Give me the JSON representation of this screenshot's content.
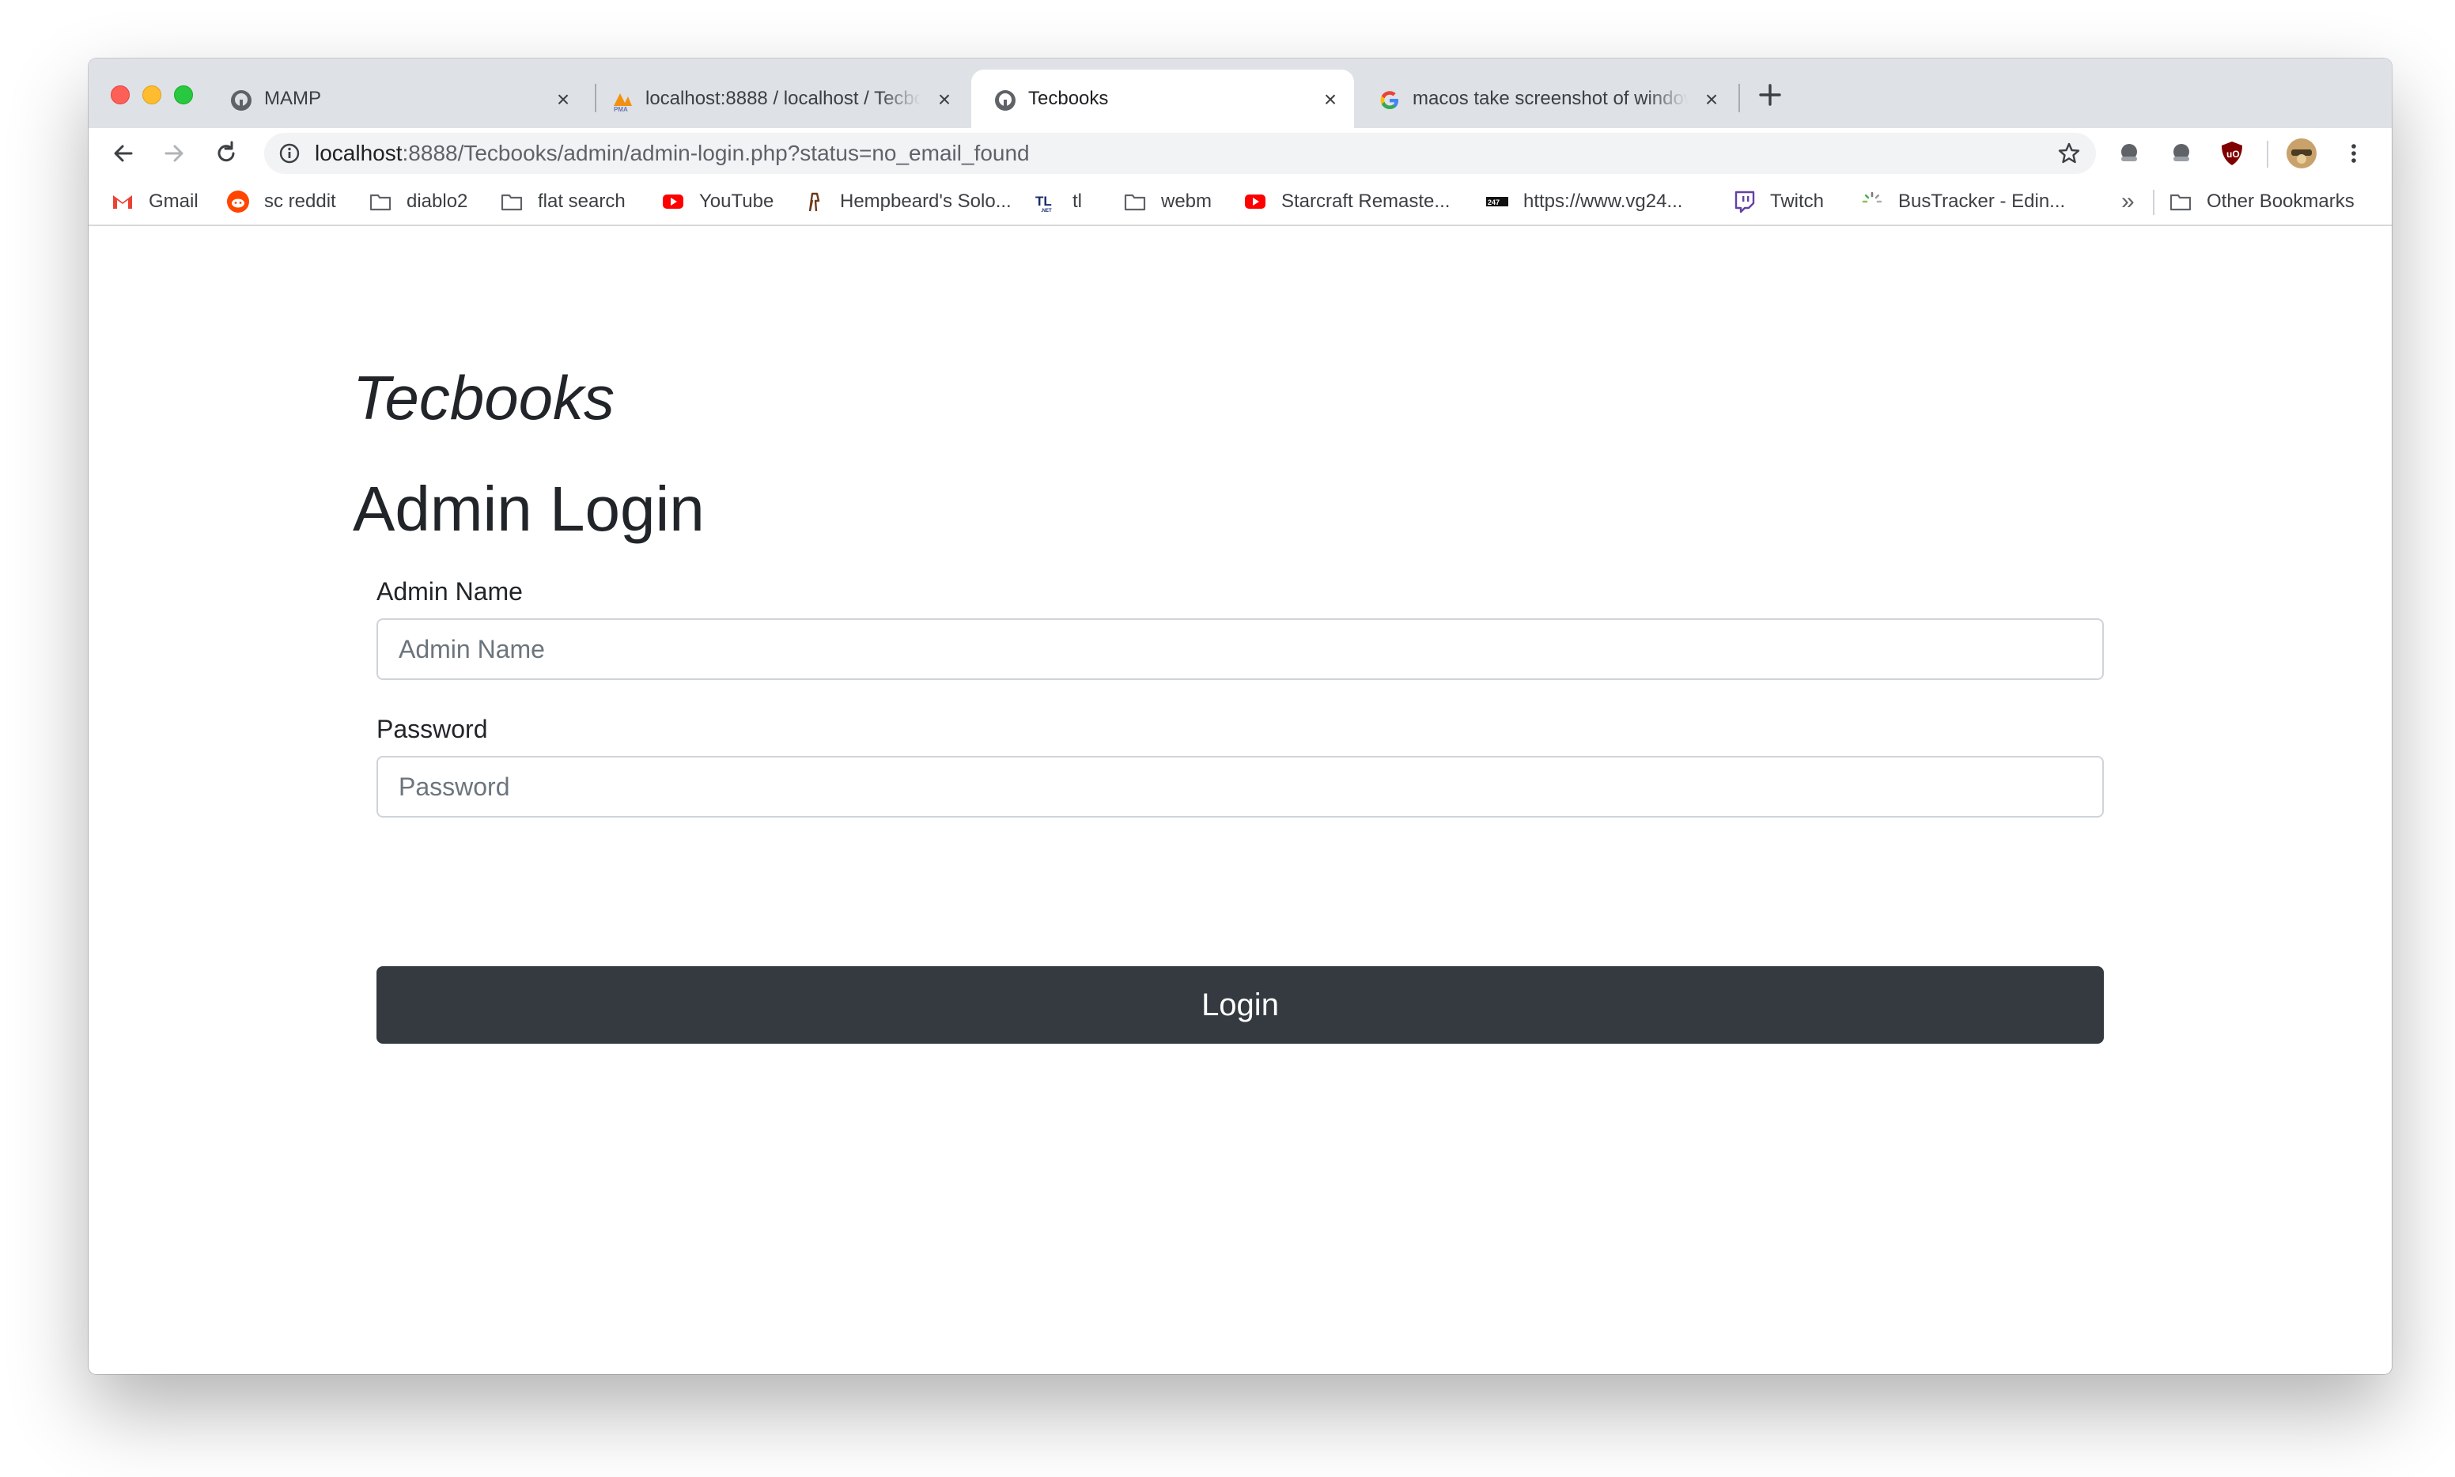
{
  "browser": {
    "tabs": [
      {
        "title": "MAMP",
        "active": false,
        "icon": "mamp-elephant-icon"
      },
      {
        "title": "localhost:8888 / localhost / Tecbooks",
        "active": false,
        "icon": "phpmyadmin-icon"
      },
      {
        "title": "Tecbooks",
        "active": true,
        "icon": "mamp-elephant-icon"
      },
      {
        "title": "macos take screenshot of window",
        "active": false,
        "icon": "google-icon"
      }
    ],
    "url_host": "localhost",
    "url_rest": ":8888/Tecbooks/admin/admin-login.php?status=no_email_found",
    "bookmarks": [
      {
        "label": "Gmail",
        "icon": "gmail-icon"
      },
      {
        "label": "sc reddit",
        "icon": "reddit-icon"
      },
      {
        "label": "diablo2",
        "icon": "folder-icon"
      },
      {
        "label": "flat search",
        "icon": "folder-icon"
      },
      {
        "label": "YouTube",
        "icon": "youtube-icon"
      },
      {
        "label": "Hempbeard's Solo...",
        "icon": "hempbeard-icon"
      },
      {
        "label": "tl",
        "icon": "teamliquid-icon"
      },
      {
        "label": "webm",
        "icon": "folder-icon"
      },
      {
        "label": "Starcraft Remaste...",
        "icon": "youtube-icon"
      },
      {
        "label": "https://www.vg24...",
        "icon": "vg247-icon"
      },
      {
        "label": "Twitch",
        "icon": "twitch-icon"
      },
      {
        "label": "BusTracker - Edin...",
        "icon": "loading-spinner-icon"
      }
    ],
    "overflow_label": "»",
    "other_bookmarks": "Other Bookmarks"
  },
  "page": {
    "brand": "Tecbooks",
    "heading": "Admin Login",
    "admin_name_label": "Admin Name",
    "admin_name_placeholder": "Admin Name",
    "admin_name_value": "",
    "password_label": "Password",
    "password_placeholder": "Password",
    "password_value": "",
    "login_button": "Login"
  },
  "colors": {
    "button_bg": "#343a40",
    "text": "#212529",
    "tabstrip": "#dee1e6"
  }
}
